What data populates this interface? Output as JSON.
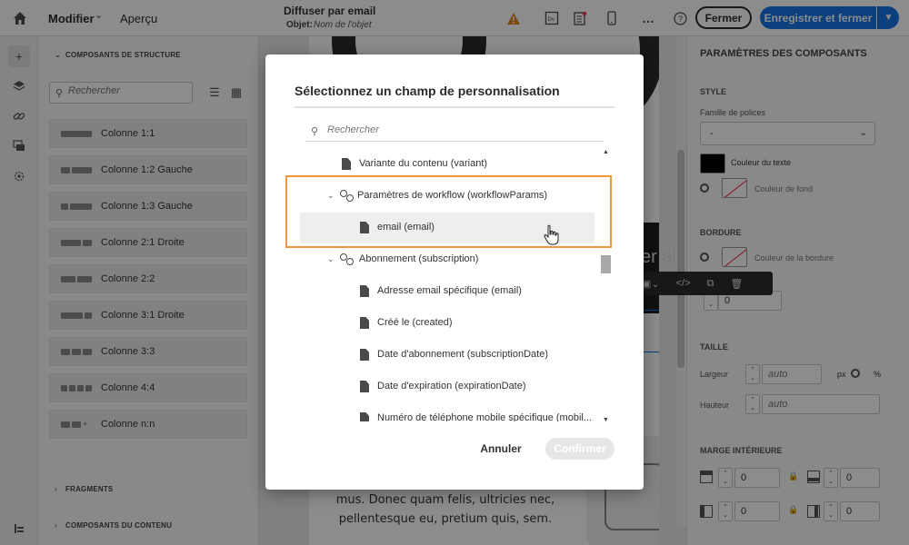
{
  "topbar": {
    "menu_modifier": "Modifier",
    "menu_apercu": "Aperçu",
    "doc_title": "Diffuser par email",
    "doc_object_label": "Objet:",
    "doc_object_value": "Nom de l'objet",
    "btn_close": "Fermer",
    "btn_save_close": "Enregistrer et fermer",
    "icons": [
      "home-icon",
      "warning-icon",
      "desktop-preview-icon",
      "checklist-icon",
      "mobile-icon",
      "more-icon",
      "help-icon",
      "chevron-down-icon"
    ],
    "accent": "#1473e6",
    "warning_color": "#e68619"
  },
  "rail": {
    "icons": [
      "add-icon",
      "layers-icon",
      "link-icon",
      "assets-icon",
      "settings-icon",
      "bottom-icon"
    ]
  },
  "left_panel": {
    "structure_header": "COMPOSANTS DE STRUCTURE",
    "search_placeholder": "Rechercher",
    "components": [
      {
        "label": "Colonne 1:1"
      },
      {
        "label": "Colonne 1:2 Gauche"
      },
      {
        "label": "Colonne 1:3 Gauche"
      },
      {
        "label": "Colonne 2:1 Droite"
      },
      {
        "label": "Colonne 2:2"
      },
      {
        "label": "Colonne 3:1 Droite"
      },
      {
        "label": "Colonne 3:3"
      },
      {
        "label": "Colonne 4:4"
      },
      {
        "label": "Colonne n:n"
      }
    ],
    "fragments_header": "FRAGMENTS",
    "content_header": "COMPOSANTS DU CONTENU"
  },
  "canvas": {
    "hero_text": "er ac",
    "body_line_1": "mus. Donec quam felis, ultricies nec,",
    "body_line_2": "pellentesque eu, pretium quis, sem."
  },
  "right_panel": {
    "title": "PARAMÈTRES DES COMPOSANTS",
    "style_header": "STYLE",
    "font_family_label": "Famille de polices",
    "font_family_value": "-",
    "text_color_label": "Couleur du texte",
    "bg_color_label": "Couleur de fond",
    "border_header": "BORDURE",
    "border_color_label": "Couleur de la bordure",
    "border_width_value": "0",
    "size_header": "TAILLE",
    "width_label": "Largeur",
    "width_value": "auto",
    "unit_px": "px",
    "unit_pct": "%",
    "height_label": "Hauteur",
    "height_value": "auto",
    "padding_header": "MARGE INTÉRIEURE",
    "padding_values": [
      "0",
      "0",
      "0",
      "0"
    ]
  },
  "modal": {
    "title": "Sélectionnez un champ de personnalisation",
    "search_placeholder": "Rechercher",
    "tree": [
      {
        "label": "Variante du contenu (variant)",
        "type": "file"
      },
      {
        "label": "Paramètres de workflow (workflowParams)",
        "type": "group"
      },
      {
        "label": "email (email)",
        "type": "file"
      },
      {
        "label": "Abonnement (subscription)",
        "type": "group"
      },
      {
        "label": "Adresse email spécifique (email)",
        "type": "file"
      },
      {
        "label": "Créé le (created)",
        "type": "file"
      },
      {
        "label": "Date d'abonnement (subscriptionDate)",
        "type": "file"
      },
      {
        "label": "Date d'expiration (expirationDate)",
        "type": "file"
      },
      {
        "label": "Numéro de téléphone mobile spécifique (mobil...",
        "type": "file"
      }
    ],
    "btn_cancel": "Annuler",
    "btn_confirm": "Confirmer",
    "highlight_color": "#f0963c"
  }
}
